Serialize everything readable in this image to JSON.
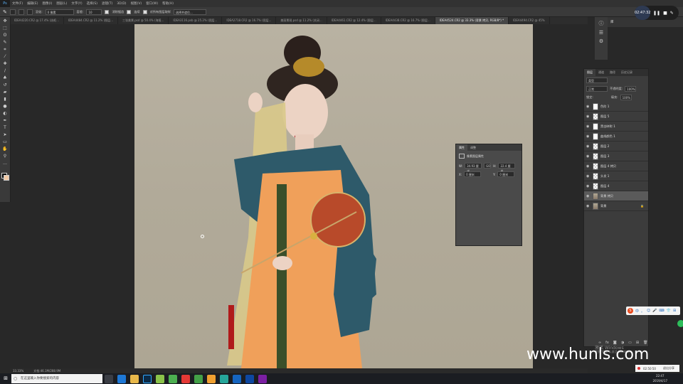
{
  "app": {
    "logo": "Ps",
    "logo_icon": "photoshop-icon"
  },
  "menu": [
    "文件(F)",
    "编辑(E)",
    "图像(I)",
    "图层(L)",
    "文字(Y)",
    "选择(S)",
    "滤镜(T)",
    "3D(D)",
    "视图(V)",
    "窗口(W)",
    "帮助(H)"
  ],
  "options": {
    "mode_label": "新选区",
    "feather_label": "羽化:",
    "feather_value": "0 像素",
    "tolerance_label": "容差:",
    "tolerance_value": "10",
    "antialias_label": "消除锯齿",
    "contiguous_label": "连续",
    "sample_all_label": "对所有图层取样",
    "select_subject": "选择并遮住..."
  },
  "tabs": [
    {
      "label": "IDEA4220.CR2 @ 17.4% (选框...",
      "active": false
    },
    {
      "label": "IDEA4484.CR2 @ 11.2% (图层...",
      "active": false
    },
    {
      "label": "三张美景.psd @ 50.4% (海报...",
      "active": false
    },
    {
      "label": "IDEA3116.psb @ 25.2% (图层...",
      "active": false
    },
    {
      "label": "IDEA2718.CR2 @ 16.7% (图层...",
      "active": false
    },
    {
      "label": "美丽景观.psd @ 11.2% (关闭...",
      "active": false
    },
    {
      "label": "IDEA4461.CR2 @ 12.4% (图层...",
      "active": false
    },
    {
      "label": "IDEA4438.CR2 @ 16.7% (图层...",
      "active": false
    },
    {
      "label": "IDEA4524.CR2 @ 33.3% (背景 拷贝, RGB/8*) *",
      "active": true
    },
    {
      "label": "IDEA4494.CR2 @ 45%",
      "active": false
    }
  ],
  "status": {
    "zoom": "33.33%",
    "doc": "文档:46.1M/288.9M"
  },
  "library_tab": "库",
  "layers_panel": {
    "tabs": [
      "图层",
      "通道",
      "路径",
      "历史记录"
    ],
    "kind": "类型",
    "blend": "正常",
    "opacity_label": "不透明度:",
    "opacity": "100%",
    "lock_label": "锁定:",
    "fill_label": "填充:",
    "fill": "100%",
    "layers": [
      {
        "name": "色阶 1",
        "thumb": "white",
        "selected": false
      },
      {
        "name": "图层 5",
        "thumb": "checker",
        "selected": false
      },
      {
        "name": "黑白映射 1",
        "thumb": "white",
        "selected": false
      },
      {
        "name": "曲线颜色 1",
        "thumb": "white",
        "selected": false
      },
      {
        "name": "图层 2",
        "thumb": "checker",
        "selected": false
      },
      {
        "name": "图层 3",
        "thumb": "checker",
        "selected": false
      },
      {
        "name": "图层 4 拷贝",
        "thumb": "checker",
        "selected": false
      },
      {
        "name": "头发 1",
        "thumb": "checker",
        "selected": false
      },
      {
        "name": "图层 4",
        "thumb": "checker",
        "selected": false
      },
      {
        "name": "背景 拷贝",
        "thumb": "img",
        "selected": true
      },
      {
        "name": "背景",
        "thumb": "img",
        "selected": false
      }
    ]
  },
  "properties": {
    "tabs": [
      "属性",
      "调整"
    ],
    "title": "像素图层属性",
    "w_label": "W:",
    "w_value": "34.93 厘米",
    "go_label": "GO",
    "h_label": "H:",
    "h_value": "22.4 厘米",
    "x_label": "X:",
    "x_value": "0 厘米",
    "y_label": "Y:",
    "y_value": "0 厘米"
  },
  "recorder": {
    "time": "02:47:32"
  },
  "record_bar": {
    "time": "02:50:50",
    "btn": "退出分享"
  },
  "watermark": "www.hunls.com",
  "windows_activation": {
    "line1": "激活 Windows",
    "line2": "转到\"设置\"以激活 Windows。"
  },
  "taskbar": {
    "search_placeholder": "在这里输入你要搜索的内容",
    "time": "22:47",
    "date": "2019/4/17",
    "icons": [
      "task-view-icon",
      "edge-icon",
      "file-explorer-icon",
      "photoshop-icon",
      "app1-icon",
      "app2-icon",
      "app3-icon",
      "app4-icon",
      "wechat-icon",
      "app5-icon",
      "app6-icon",
      "app7-icon",
      "app8-icon"
    ]
  },
  "ime": {
    "label": "中",
    "icons": [
      "。",
      "☺",
      "🎤",
      "⌨",
      "👕",
      "⊞"
    ]
  },
  "colors": {
    "accent": "#d33333",
    "ps_blue": "#5ab0f7",
    "canvas_bg": "#b1aa99"
  }
}
